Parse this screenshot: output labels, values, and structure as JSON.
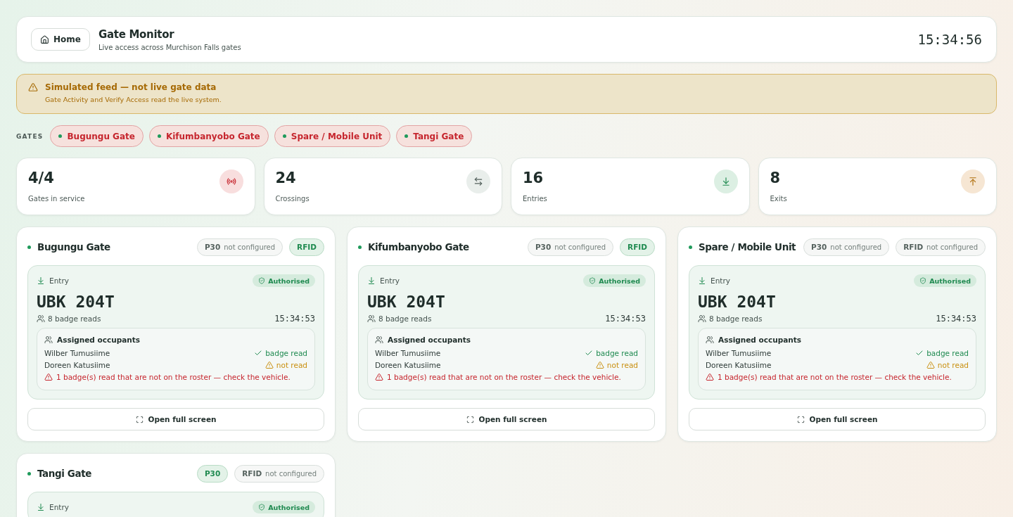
{
  "header": {
    "home_label": "Home",
    "title": "Gate Monitor",
    "subtitle": "Live access across Murchison Falls gates",
    "clock": "15:34:56"
  },
  "banner": {
    "title": "Simulated feed — not live gate data",
    "text": "Gate Activity and Verify Access read the live system."
  },
  "gates_filter": {
    "label": "GATES",
    "items": [
      {
        "label": "Bugungu Gate",
        "selected": true
      },
      {
        "label": "Kifumbanyobo Gate",
        "selected": true
      },
      {
        "label": "Spare / Mobile Unit",
        "selected": true
      },
      {
        "label": "Tangi Gate",
        "selected": true
      }
    ]
  },
  "stats": [
    {
      "value": "4/4",
      "label": "Gates in service",
      "kind": "signal"
    },
    {
      "value": "24",
      "label": "Crossings",
      "kind": "swap"
    },
    {
      "value": "16",
      "label": "Entries",
      "kind": "entry"
    },
    {
      "value": "8",
      "label": "Exits",
      "kind": "exit"
    }
  ],
  "gates": [
    {
      "name": "Bugungu Gate",
      "online": true,
      "sensors": [
        {
          "label": "P30",
          "configured": false,
          "note": "not configured"
        },
        {
          "label": "RFID",
          "configured": true
        }
      ],
      "last": {
        "direction": "Entry",
        "status": "Authorised",
        "plate": "UBK 204T",
        "reads": "8 badge reads",
        "time": "15:34:53",
        "occupants_title": "Assigned occupants",
        "occupants": [
          {
            "name": "Wilber Tumusiime",
            "kind": "read",
            "status": "badge read"
          },
          {
            "name": "Doreen Katusiime",
            "kind": "missing",
            "status": "not read"
          }
        ],
        "warning": "1 badge(s) read that are not on the roster — check the vehicle."
      },
      "action": "Open full screen"
    },
    {
      "name": "Kifumbanyobo Gate",
      "online": true,
      "sensors": [
        {
          "label": "P30",
          "configured": false,
          "note": "not configured"
        },
        {
          "label": "RFID",
          "configured": true
        }
      ],
      "last": {
        "direction": "Entry",
        "status": "Authorised",
        "plate": "UBK 204T",
        "reads": "8 badge reads",
        "time": "15:34:53",
        "occupants_title": "Assigned occupants",
        "occupants": [
          {
            "name": "Wilber Tumusiime",
            "kind": "read",
            "status": "badge read"
          },
          {
            "name": "Doreen Katusiime",
            "kind": "missing",
            "status": "not read"
          }
        ],
        "warning": "1 badge(s) read that are not on the roster — check the vehicle."
      },
      "action": "Open full screen"
    },
    {
      "name": "Spare / Mobile Unit",
      "online": true,
      "sensors": [
        {
          "label": "P30",
          "configured": false,
          "note": "not configured"
        },
        {
          "label": "RFID",
          "configured": false,
          "note": "not configured"
        }
      ],
      "last": {
        "direction": "Entry",
        "status": "Authorised",
        "plate": "UBK 204T",
        "reads": "8 badge reads",
        "time": "15:34:53",
        "occupants_title": "Assigned occupants",
        "occupants": [
          {
            "name": "Wilber Tumusiime",
            "kind": "read",
            "status": "badge read"
          },
          {
            "name": "Doreen Katusiime",
            "kind": "missing",
            "status": "not read"
          }
        ],
        "warning": "1 badge(s) read that are not on the roster — check the vehicle."
      },
      "action": "Open full screen"
    },
    {
      "name": "Tangi Gate",
      "online": true,
      "sensors": [
        {
          "label": "P30",
          "configured": true
        },
        {
          "label": "RFID",
          "configured": false,
          "note": "not configured"
        }
      ],
      "last": {
        "direction": "Entry",
        "status": "Authorised"
      }
    }
  ]
}
